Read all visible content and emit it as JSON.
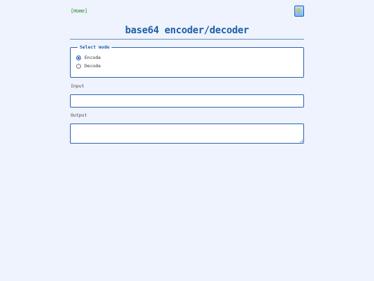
{
  "nav": {
    "home_label": "[Home]"
  },
  "theme_toggle": {
    "icon": "sun-moon-icon"
  },
  "header": {
    "title": "base64 encoder/decoder"
  },
  "mode": {
    "legend": "Select mode",
    "options": [
      {
        "label": "Encode",
        "selected": true
      },
      {
        "label": "Decode",
        "selected": false
      }
    ]
  },
  "input": {
    "label": "Input",
    "value": ""
  },
  "output": {
    "label": "Output",
    "value": ""
  },
  "colors": {
    "background": "#eef3fe",
    "accent": "#1e5fa8",
    "border": "#2a62b0",
    "home_link": "#1f8a1f"
  }
}
